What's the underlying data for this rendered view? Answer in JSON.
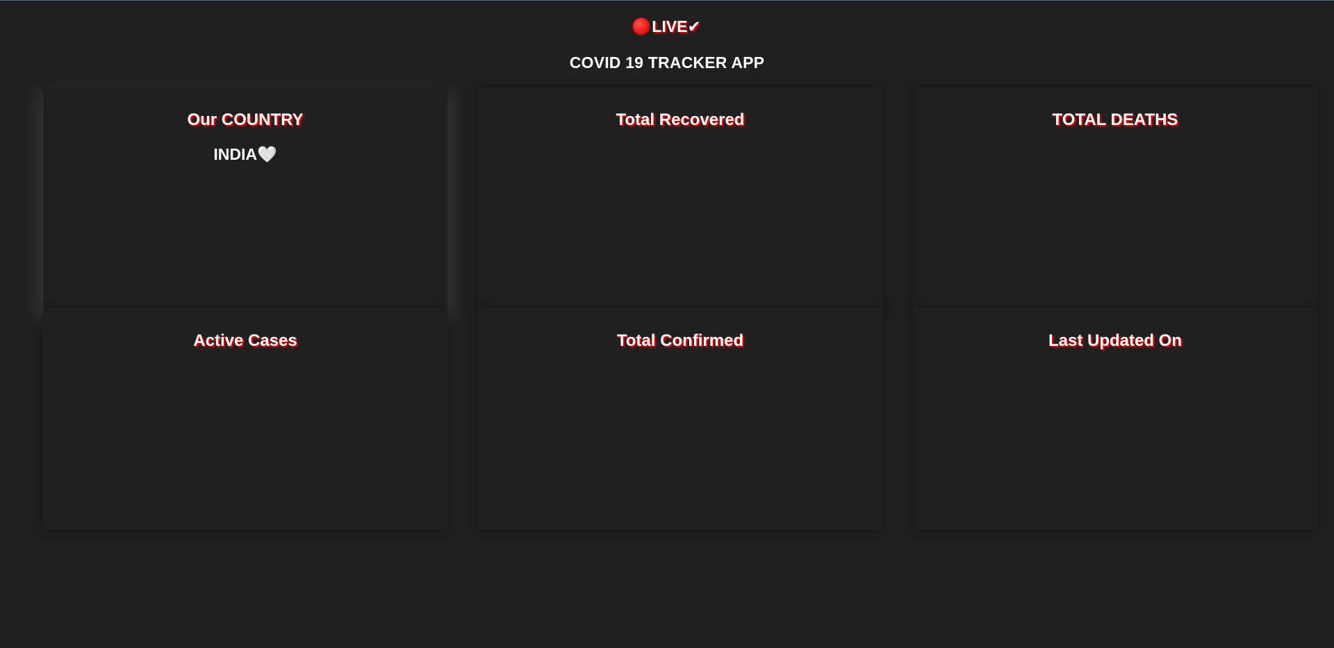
{
  "header": {
    "live_label": "LIVE✔",
    "title": "COVID 19 TRACKER APP"
  },
  "cards": [
    {
      "title": "Our COUNTRY",
      "value": "INDIA🤍"
    },
    {
      "title": "Total Recovered",
      "value": ""
    },
    {
      "title": "TOTAL DEATHS",
      "value": ""
    },
    {
      "title": "Active Cases",
      "value": ""
    },
    {
      "title": "Total Confirmed",
      "value": ""
    },
    {
      "title": "Last Updated On",
      "value": ""
    }
  ],
  "colors": {
    "background": "#202020",
    "text": "#ffffff",
    "accent": "#ff0000"
  }
}
